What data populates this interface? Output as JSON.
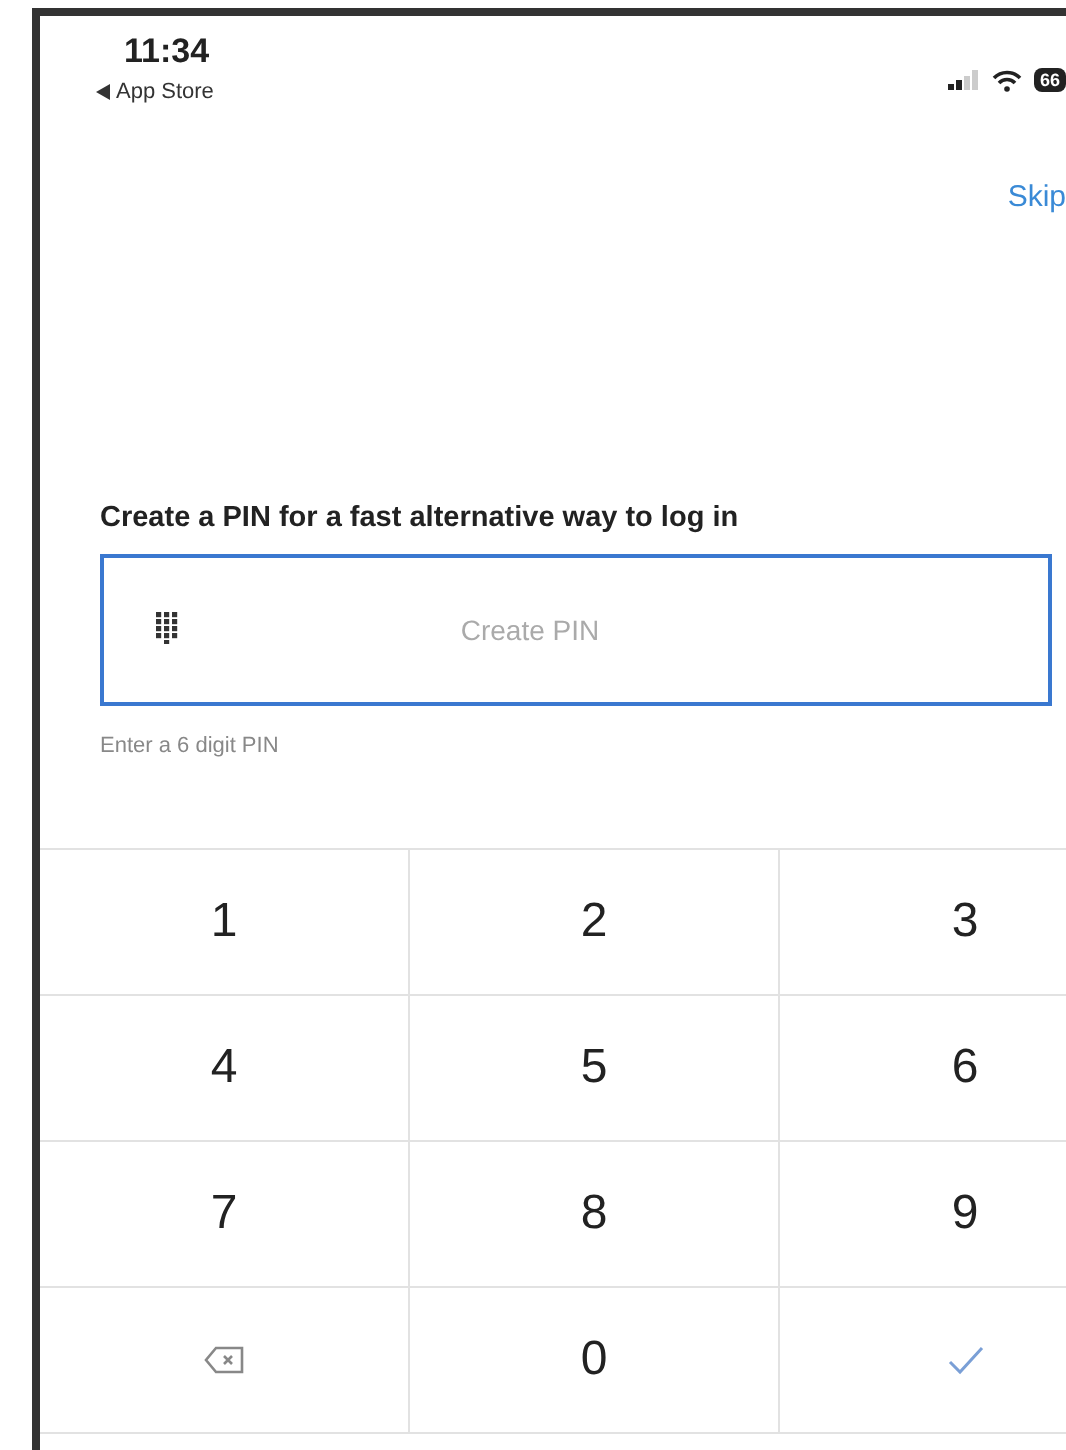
{
  "status_bar": {
    "time": "11:34",
    "back_label": "App Store",
    "battery": "66"
  },
  "skip": {
    "label": "Skip"
  },
  "heading": "Create a PIN for a fast alternative way to log in",
  "pin_field": {
    "placeholder": "Create PIN",
    "focused": true
  },
  "hint": "Enter a 6 digit PIN",
  "keys": [
    {
      "kind": "digit",
      "label": "1"
    },
    {
      "kind": "digit",
      "label": "2"
    },
    {
      "kind": "digit",
      "label": "3"
    },
    {
      "kind": "digit",
      "label": "4"
    },
    {
      "kind": "digit",
      "label": "5"
    },
    {
      "kind": "digit",
      "label": "6"
    },
    {
      "kind": "digit",
      "label": "7"
    },
    {
      "kind": "digit",
      "label": "8"
    },
    {
      "kind": "digit",
      "label": "9"
    },
    {
      "kind": "backspace"
    },
    {
      "kind": "digit",
      "label": "0"
    },
    {
      "kind": "confirm"
    }
  ]
}
